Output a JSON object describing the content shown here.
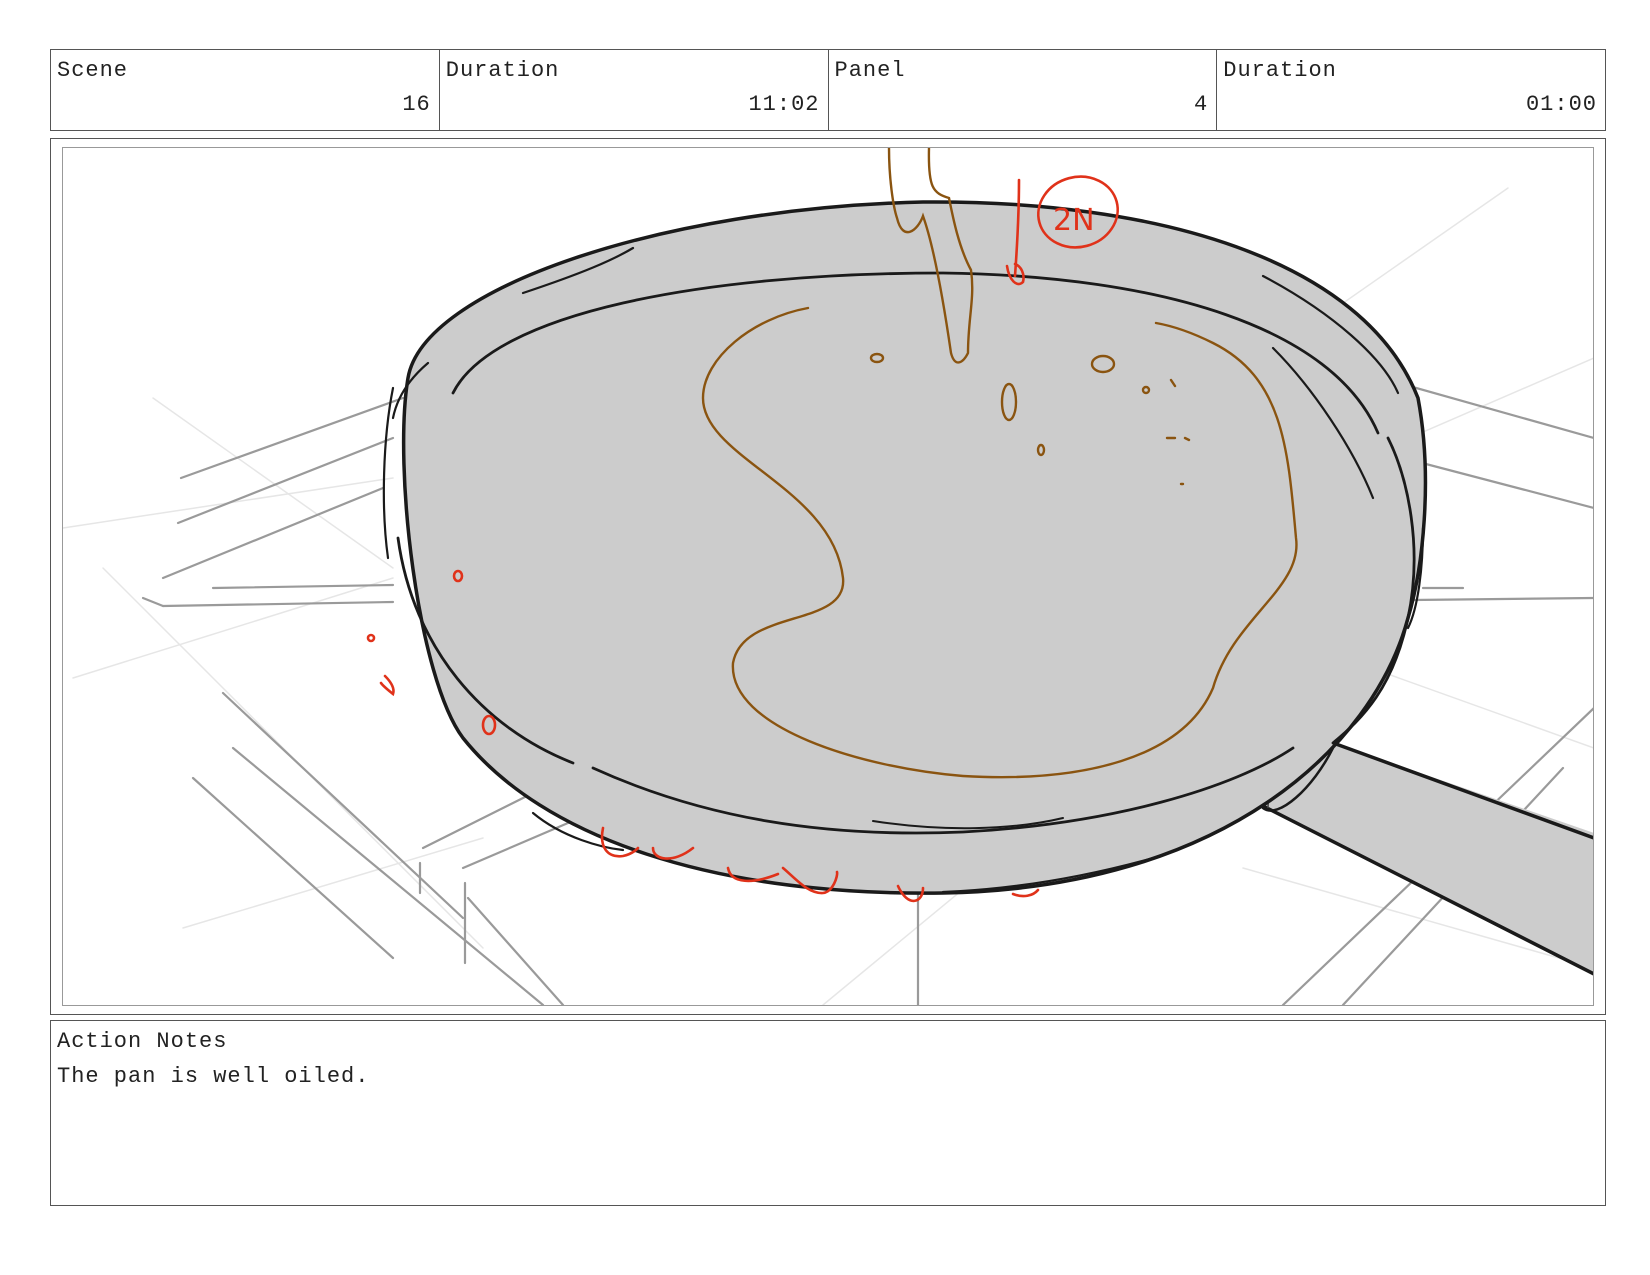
{
  "header": {
    "scene_label": "Scene",
    "scene_value": "16",
    "scene_duration_label": "Duration",
    "scene_duration_value": "11:02",
    "panel_label": "Panel",
    "panel_value": "4",
    "panel_duration_label": "Duration",
    "panel_duration_value": "01:00"
  },
  "frame": {
    "annotation": "2N",
    "colors": {
      "pan_fill": "#cccccc",
      "outline": "#1a1a1a",
      "oil": "#8a5410",
      "markup": "#e0321a",
      "grid": "#9a9a9a"
    }
  },
  "notes": {
    "label": "Action Notes",
    "text": "The pan is well oiled."
  }
}
